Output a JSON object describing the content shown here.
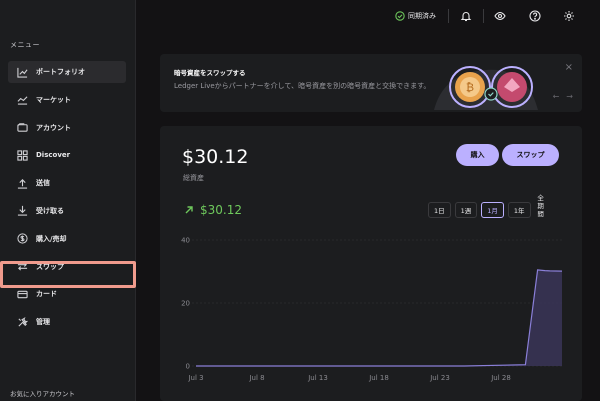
{
  "window": {
    "controls": [
      {
        "name": "close",
        "color": "#fe5f57"
      },
      {
        "name": "minimize",
        "color": "#febc2e"
      },
      {
        "name": "maximize",
        "color": "#28c840"
      }
    ]
  },
  "sidebar": {
    "menu_label": "メニュー",
    "items": [
      {
        "label": "ポートフォリオ",
        "icon": "chart-line-icon",
        "active": true
      },
      {
        "label": "マーケット",
        "icon": "market-icon"
      },
      {
        "label": "アカウント",
        "icon": "wallet-icon"
      },
      {
        "label": "Discover",
        "icon": "grid-icon"
      },
      {
        "label": "送信",
        "icon": "arrow-up-icon"
      },
      {
        "label": "受け取る",
        "icon": "arrow-down-icon",
        "highlighted": true
      },
      {
        "label": "購入/売却",
        "icon": "dollar-circle-icon"
      },
      {
        "label": "スワップ",
        "icon": "swap-icon"
      },
      {
        "label": "カード",
        "icon": "card-icon"
      },
      {
        "label": "管理",
        "icon": "tools-icon"
      }
    ],
    "favorites_label": "お気に入りアカウント"
  },
  "topbar": {
    "sync_label": "同期済み",
    "icons": [
      "bell-icon",
      "eye-icon",
      "help-icon",
      "gear-icon"
    ]
  },
  "banner": {
    "title": "暗号資産をスワップする",
    "description": "Ledger Liveからパートナーを介して、暗号資産を別の暗号資産と交換できます。",
    "close": "×",
    "prev": "←",
    "next": "→"
  },
  "portfolio": {
    "balance": "$30.12",
    "balance_label": "総資産",
    "buy_label": "購入",
    "swap_label": "スワップ",
    "change": "$30.12",
    "ranges": [
      {
        "label": "1日"
      },
      {
        "label": "1週"
      },
      {
        "label": "1月",
        "selected": true
      },
      {
        "label": "1年"
      },
      {
        "label": "全期間",
        "vertical": true
      }
    ]
  },
  "chart_data": {
    "type": "area",
    "y_ticks": [
      0,
      20,
      40
    ],
    "ylim": [
      0,
      40
    ],
    "x_ticks": [
      "Jul 3",
      "Jul 8",
      "Jul 13",
      "Jul 18",
      "Jul 23",
      "Jul 28"
    ],
    "x_range_days": [
      3,
      33
    ],
    "series": [
      {
        "x": [
          3,
          5,
          10,
          15,
          20,
          25,
          30,
          31,
          31.6,
          32,
          33
        ],
        "y": [
          0,
          0,
          0,
          0,
          0,
          0,
          0.4,
          30.5,
          30.3,
          30.2,
          30.12
        ]
      }
    ],
    "colors": {
      "line": "#8a7fd8",
      "fill": "#3a3558",
      "grid": "#2e2e31",
      "axis_text": "#8a8a90"
    }
  }
}
